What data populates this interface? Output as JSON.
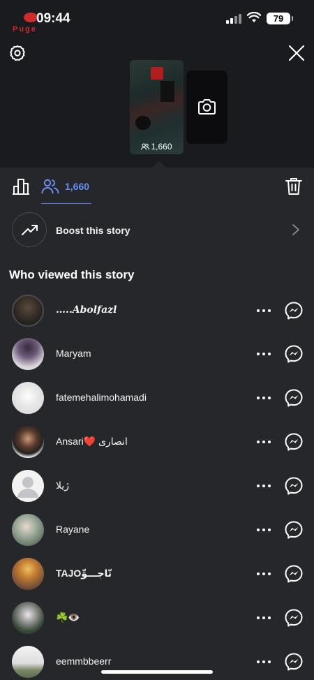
{
  "status_bar": {
    "time": "09:44",
    "battery": "79",
    "logo_text": "Puge"
  },
  "story": {
    "view_count": "1,660"
  },
  "tabs": {
    "viewers_count": "1,660"
  },
  "boost": {
    "label": "Boost this story"
  },
  "viewers_section": {
    "title": "Who viewed this story"
  },
  "viewers": [
    {
      "name": "…..𝑨𝒃𝒐𝒍𝒇𝒂𝒛𝒍"
    },
    {
      "name": "Maryam"
    },
    {
      "name": "fatemehalimohamadi"
    },
    {
      "name": "Ansari❤️ انصاری"
    },
    {
      "name": "ژیلا"
    },
    {
      "name": "Rayane"
    },
    {
      "name": "TAJOتّاجـــوِّ"
    },
    {
      "name": "☘️👁️"
    },
    {
      "name": "eemmbbeerr"
    }
  ],
  "colors": {
    "background": "#26272b",
    "top_background": "#1a1b1e",
    "accent": "#6a8ef0"
  },
  "icons": {
    "settings": "gear-icon",
    "close": "close-icon",
    "camera": "camera-icon",
    "insights": "bar-chart-icon",
    "viewers": "people-icon",
    "delete": "trash-icon",
    "boost": "trending-up-icon",
    "more": "more-horizontal-icon",
    "message": "messenger-icon"
  }
}
